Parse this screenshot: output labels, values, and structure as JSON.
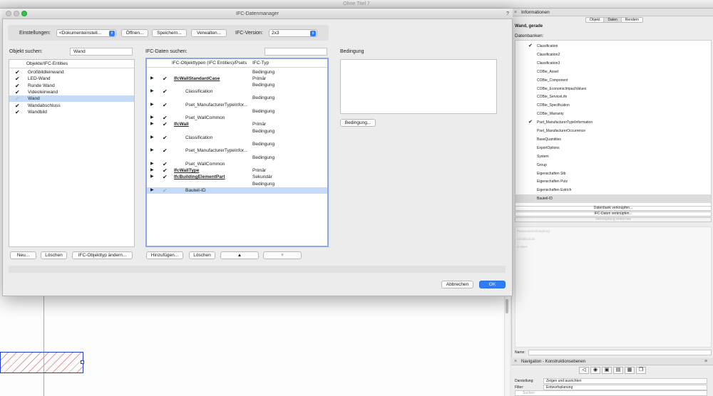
{
  "app": {
    "title": "Ohne Titel 7"
  },
  "dialog": {
    "title": "IFC-Datenmanager",
    "help": "?",
    "settings": {
      "label": "Einstellungen:",
      "value": "<Dokumenteinstell...",
      "open": "Öffnen...",
      "save": "Speichern...",
      "manage": "Verwalten...",
      "version_label": "IFC-Version:",
      "version_value": "2x3"
    },
    "object_search": {
      "label": "Objekt suchen:",
      "value": "Wand"
    },
    "object_list": {
      "header": "Objekte/IFC-Entities",
      "rows": [
        {
          "label": "Großbildleinwand",
          "checked": "✔"
        },
        {
          "label": "LED-Wand",
          "checked": "✔"
        },
        {
          "label": "Runde Wand",
          "checked": "✔"
        },
        {
          "label": "Videoleinwand",
          "checked": "✔"
        },
        {
          "label": "Wand",
          "checked": "✔"
        },
        {
          "label": "Wandabschluss",
          "checked": "✔"
        },
        {
          "label": "Wandbild",
          "checked": "✔"
        }
      ]
    },
    "left_buttons": {
      "new": "Neu...",
      "delete": "Löschen",
      "change": "IFC-Objekttyp ändern..."
    },
    "ifc_search": {
      "label": "IFC-Daten suchen:",
      "value": ""
    },
    "ifc_list": {
      "header_name": "IFC-Objekttypen (IFC Entities)/Psets",
      "header_type": "IFC-Typ",
      "rows": [
        {
          "name": "",
          "type": "Bedingung"
        },
        {
          "name": "IfcWallStandardCase",
          "type": "Primär"
        },
        {
          "name": "",
          "type": "Bedingung"
        },
        {
          "name": "Classification",
          "type": ""
        },
        {
          "name": "",
          "type": "Bedingung"
        },
        {
          "name": "Pset_ManufacturerTypeInfor...",
          "type": ""
        },
        {
          "name": "",
          "type": "Bedingung"
        },
        {
          "name": "Pset_WallCommon",
          "type": ""
        },
        {
          "name": "IfcWall",
          "type": "Primär"
        },
        {
          "name": "",
          "type": "Bedingung"
        },
        {
          "name": "Classification",
          "type": ""
        },
        {
          "name": "",
          "type": "Bedingung"
        },
        {
          "name": "Pset_ManufacturerTypeInfor...",
          "type": ""
        },
        {
          "name": "",
          "type": "Bedingung"
        },
        {
          "name": "Pset_WallCommon",
          "type": ""
        },
        {
          "name": "IfcWallType",
          "type": "Primär"
        },
        {
          "name": "IfcBuildingElementPart",
          "type": "Sekundär"
        },
        {
          "name": "",
          "type": "Bedingung"
        },
        {
          "name": "Bauteil-ID",
          "type": ""
        }
      ]
    },
    "mid_buttons": {
      "add": "Hinzufügen...",
      "delete": "Löschen",
      "up": "▲",
      "down": "▼"
    },
    "condition": {
      "label": "Bedingung",
      "button": "Bedingung..."
    },
    "footer": {
      "cancel": "Abbrechen",
      "ok": "OK"
    }
  },
  "info_palette": {
    "title": "Informationen",
    "tabs": [
      "Objekt",
      "Daten",
      "Rendern"
    ],
    "object_type": "Wand, gerade",
    "databases_label": "Datenbanken:",
    "databases": [
      {
        "label": "Classification",
        "checked": "✔"
      },
      {
        "label": "Classification2",
        "checked": ""
      },
      {
        "label": "Classification3",
        "checked": ""
      },
      {
        "label": "COBie_Asset",
        "checked": ""
      },
      {
        "label": "COBie_Component",
        "checked": ""
      },
      {
        "label": "COBie_EconomicImpactValues",
        "checked": ""
      },
      {
        "label": "COBie_ServiceLife",
        "checked": ""
      },
      {
        "label": "COBie_Specification",
        "checked": ""
      },
      {
        "label": "COBie_Warranty",
        "checked": ""
      },
      {
        "label": "Pset_ManufacturerTypeInformation",
        "checked": "✔"
      },
      {
        "label": "Pset_ManufacturerOccurrence",
        "checked": ""
      },
      {
        "label": "BaseQuantities",
        "checked": ""
      },
      {
        "label": "ExportOptions",
        "checked": ""
      },
      {
        "label": "System",
        "checked": ""
      },
      {
        "label": "Group",
        "checked": ""
      },
      {
        "label": "Eigenschaften Stb",
        "checked": ""
      },
      {
        "label": "Eigenschaften Putz",
        "checked": ""
      },
      {
        "label": "Eigenschaften Estrich",
        "checked": ""
      },
      {
        "label": "Bauteil-ID",
        "checked": ""
      }
    ],
    "buttons": {
      "link_db": "Datenbank verknüpfen...",
      "link_ifc": "IFC-Daten verknüpfen...",
      "remove_link": "Verknüpfung entfernen"
    },
    "params": [
      "Parameterverknüpfung",
      "Schallschutz",
      "U-Wert"
    ],
    "name_label": "Name:"
  },
  "navigation": {
    "title": "Navigation - Konstruktionsebenen",
    "display_label": "Darstellung:",
    "display_value": "Zeigen und ausrichten",
    "filter_label": "Filter:",
    "filter_value": "Entwurfsplanung",
    "search_placeholder": "Suchen"
  }
}
